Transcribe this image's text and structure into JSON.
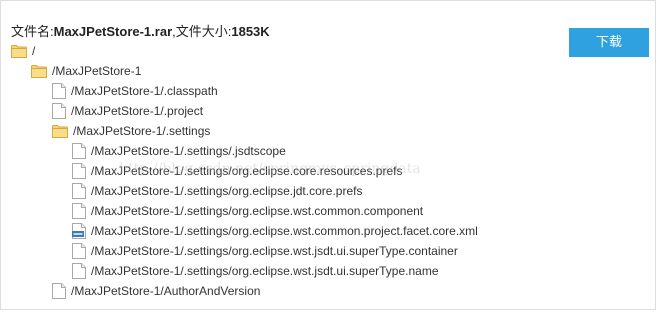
{
  "header": {
    "name_label": "文件名:",
    "file_name": "MaxJPetStore-1.rar",
    "size_label": ",文件大小:",
    "file_size": "1853K"
  },
  "download_button": {
    "label": "下载"
  },
  "watermark": {
    "text": "http://blog.csdn.net/springmvc_springdata"
  },
  "tree": [
    {
      "type": "folder",
      "path": "/"
    },
    {
      "type": "folder",
      "path": "/MaxJPetStore-1"
    },
    {
      "type": "file",
      "path": "/MaxJPetStore-1/.classpath"
    },
    {
      "type": "file",
      "path": "/MaxJPetStore-1/.project"
    },
    {
      "type": "folder",
      "path": "/MaxJPetStore-1/.settings"
    },
    {
      "type": "file",
      "path": "/MaxJPetStore-1/.settings/.jsdtscope"
    },
    {
      "type": "file",
      "path": "/MaxJPetStore-1/.settings/org.eclipse.core.resources.prefs"
    },
    {
      "type": "file",
      "path": "/MaxJPetStore-1/.settings/org.eclipse.jdt.core.prefs"
    },
    {
      "type": "file",
      "path": "/MaxJPetStore-1/.settings/org.eclipse.wst.common.component"
    },
    {
      "type": "xml-file",
      "path": "/MaxJPetStore-1/.settings/org.eclipse.wst.common.project.facet.core.xml"
    },
    {
      "type": "file",
      "path": "/MaxJPetStore-1/.settings/org.eclipse.wst.jsdt.ui.superType.container"
    },
    {
      "type": "file",
      "path": "/MaxJPetStore-1/.settings/org.eclipse.wst.jsdt.ui.superType.name"
    },
    {
      "type": "file",
      "path": "/MaxJPetStore-1/AuthorAndVersion"
    }
  ]
}
